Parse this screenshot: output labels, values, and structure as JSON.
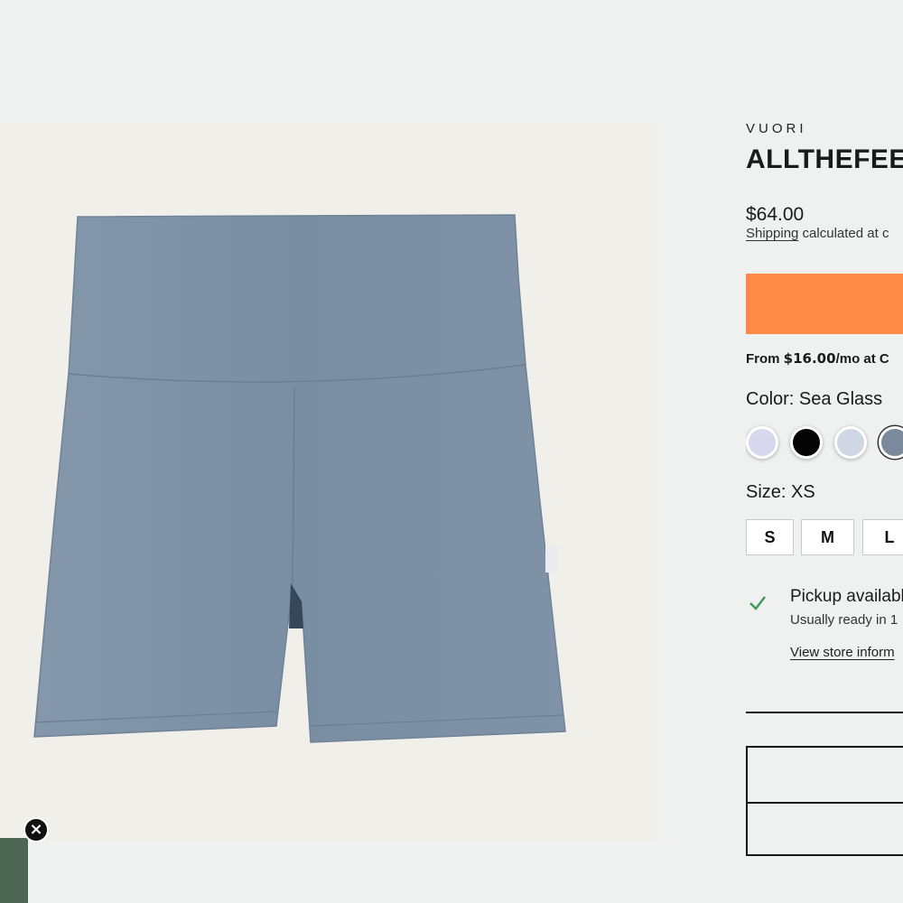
{
  "product": {
    "vendor": "VUORI",
    "title": "ALLTHEFEEL",
    "price": "$64.00",
    "shipping_link": "Shipping",
    "shipping_text": " calculated at c",
    "add_to_cart_color": "#ff8a47",
    "installments_prefix": "From ",
    "installments_amount": "$16.00",
    "installments_suffix": "/mo at C",
    "color_label": "Color: Sea Glass",
    "swatches": [
      {
        "name": "Lavender",
        "hex": "#d6d8ee"
      },
      {
        "name": "Black",
        "hex": "#050505"
      },
      {
        "name": "Light Periwinkle",
        "hex": "#cfd6e4"
      },
      {
        "name": "Sea Glass",
        "hex": "#7a8a9c",
        "selected": true
      }
    ],
    "size_label": "Size: XS",
    "sizes": [
      "S",
      "M",
      "L"
    ],
    "pickup": {
      "title": "Pickup availabl",
      "subtitle": "Usually ready in 1",
      "store_link": "View store inform"
    }
  },
  "image": {
    "background": "#f1efe9",
    "garment_color": "#7b8fa4"
  },
  "promo": {
    "close_glyph": "×",
    "tab_color": "#4d6553"
  }
}
